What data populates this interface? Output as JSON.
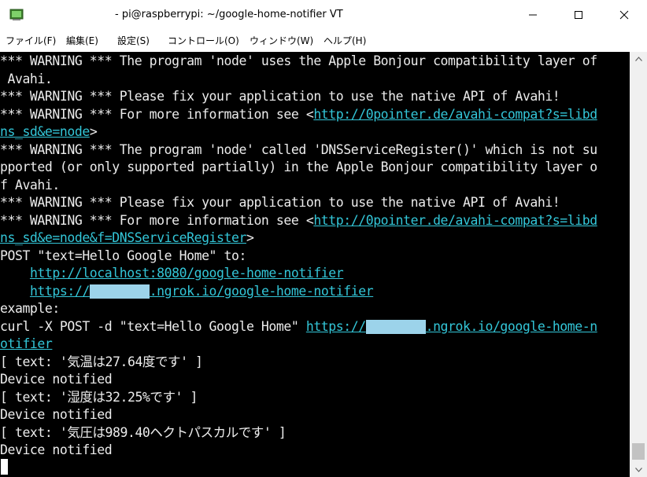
{
  "window": {
    "title": "- pi@raspberrypi: ~/google-home-notifier VT"
  },
  "menu": {
    "items": [
      "ファイル(F)",
      "編集(E)",
      "設定(S)",
      "コントロール(O)",
      "ウィンドウ(W)",
      "ヘルプ(H)"
    ]
  },
  "terminal": {
    "lines": [
      {
        "segments": [
          {
            "text": "*** WARNING *** The program 'node' uses the Apple Bonjour compatibility layer of"
          }
        ]
      },
      {
        "segments": [
          {
            "text": " Avahi."
          }
        ]
      },
      {
        "segments": [
          {
            "text": "*** WARNING *** Please fix your application to use the native API of Avahi!"
          }
        ]
      },
      {
        "segments": [
          {
            "text": "*** WARNING *** For more information see <"
          },
          {
            "text": "http://0pointer.de/avahi-compat?s=libd",
            "type": "link"
          }
        ]
      },
      {
        "segments": [
          {
            "text": "ns_sd&e=node",
            "type": "link"
          },
          {
            "text": ">"
          }
        ]
      },
      {
        "segments": [
          {
            "text": "*** WARNING *** The program 'node' called 'DNSServiceRegister()' which is not su"
          }
        ]
      },
      {
        "segments": [
          {
            "text": "pported (or only supported partially) in the Apple Bonjour compatibility layer o"
          }
        ]
      },
      {
        "segments": [
          {
            "text": "f Avahi."
          }
        ]
      },
      {
        "segments": [
          {
            "text": "*** WARNING *** Please fix your application to use the native API of Avahi!"
          }
        ]
      },
      {
        "segments": [
          {
            "text": "*** WARNING *** For more information see <"
          },
          {
            "text": "http://0pointer.de/avahi-compat?s=libd",
            "type": "link"
          }
        ]
      },
      {
        "segments": [
          {
            "text": "ns_sd&e=node&f=DNSServiceRegister",
            "type": "link"
          },
          {
            "text": ">"
          }
        ]
      },
      {
        "segments": [
          {
            "text": "POST \"text=Hello Google Home\" to:"
          }
        ]
      },
      {
        "segments": [
          {
            "text": "    "
          },
          {
            "text": "http://localhost:8080/google-home-notifier",
            "type": "link"
          }
        ]
      },
      {
        "segments": [
          {
            "text": "    "
          },
          {
            "text": "https://",
            "type": "link"
          },
          {
            "text": "xxxxxxxx",
            "type": "mask"
          },
          {
            "text": ".ngrok.io/google-home-notifier",
            "type": "link"
          }
        ]
      },
      {
        "segments": [
          {
            "text": "example:"
          }
        ]
      },
      {
        "segments": [
          {
            "text": "curl -X POST -d \"text=Hello Google Home\" "
          },
          {
            "text": "https://",
            "type": "link"
          },
          {
            "text": "xxxxxxxx",
            "type": "mask"
          },
          {
            "text": ".ngrok.io/google-home-n",
            "type": "link"
          }
        ]
      },
      {
        "segments": [
          {
            "text": "otifier",
            "type": "link"
          }
        ]
      },
      {
        "segments": [
          {
            "text": "[ text: '気温は27.64度です' ]"
          }
        ]
      },
      {
        "segments": [
          {
            "text": "Device notified"
          }
        ]
      },
      {
        "segments": [
          {
            "text": "[ text: '湿度は32.25%です' ]"
          }
        ]
      },
      {
        "segments": [
          {
            "text": "Device notified"
          }
        ]
      },
      {
        "segments": [
          {
            "text": "[ text: '気圧は989.40ヘクトパスカルです' ]"
          }
        ]
      },
      {
        "segments": [
          {
            "text": "Device notified"
          }
        ]
      }
    ]
  },
  "icons": {
    "app": "terminal-app-icon",
    "minimize": "minimize-icon",
    "maximize": "maximize-icon",
    "close": "close-icon",
    "scroll_up": "scroll-up-arrow-icon",
    "scroll_down": "scroll-down-arrow-icon"
  },
  "colors": {
    "terminal_bg": "#000000",
    "terminal_fg": "#ececec",
    "link": "#33c6d8",
    "mask": "#9cd3ea"
  }
}
